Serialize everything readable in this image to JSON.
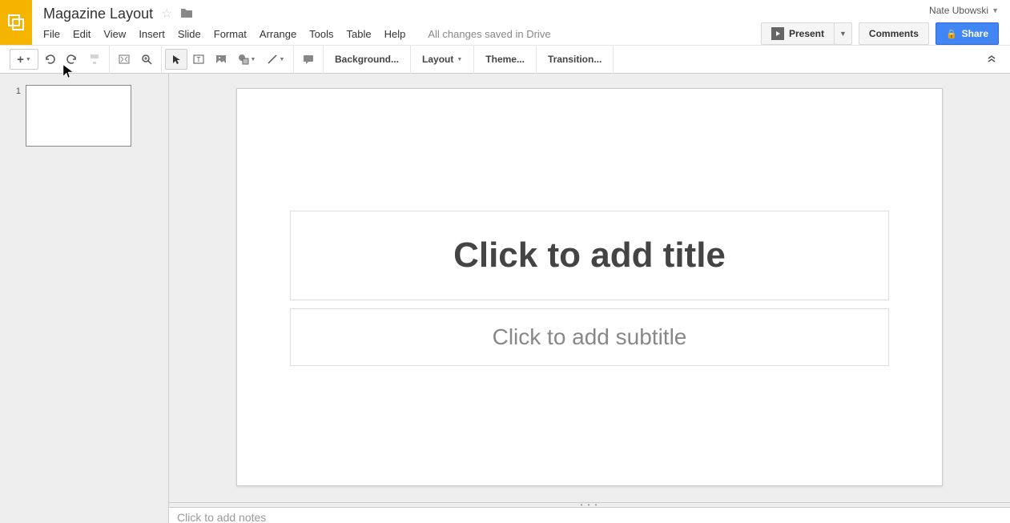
{
  "doc": {
    "title": "Magazine Layout",
    "status": "All changes saved in Drive"
  },
  "user": {
    "name": "Nate Ubowski"
  },
  "menus": [
    "File",
    "Edit",
    "View",
    "Insert",
    "Slide",
    "Format",
    "Arrange",
    "Tools",
    "Table",
    "Help"
  ],
  "actions": {
    "present": "Present",
    "comments": "Comments",
    "share": "Share"
  },
  "toolbar": {
    "background": "Background...",
    "layout": "Layout",
    "theme": "Theme...",
    "transition": "Transition..."
  },
  "filmstrip": {
    "slides": [
      {
        "num": "1"
      }
    ]
  },
  "slide": {
    "title_placeholder": "Click to add title",
    "subtitle_placeholder": "Click to add subtitle"
  },
  "notes": {
    "placeholder": "Click to add notes"
  }
}
